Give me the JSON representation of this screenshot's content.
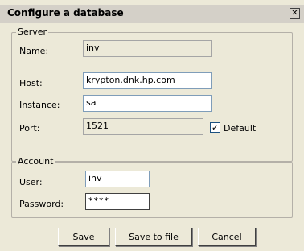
{
  "dialog": {
    "title": "Configure a database",
    "close_label": "✕"
  },
  "server": {
    "legend": "Server",
    "name_label": "Name:",
    "name_value": "inv",
    "host_label": "Host:",
    "host_value": "krypton.dnk.hp.com",
    "instance_label": "Instance:",
    "instance_value": "sa",
    "port_label": "Port:",
    "port_value": "1521",
    "default_checked": true,
    "default_label": "Default"
  },
  "account": {
    "legend": "Account",
    "user_label": "User:",
    "user_value": "inv",
    "password_label": "Password:",
    "password_value": "****"
  },
  "buttons": {
    "save": "Save",
    "save_to_file": "Save to file",
    "cancel": "Cancel"
  }
}
